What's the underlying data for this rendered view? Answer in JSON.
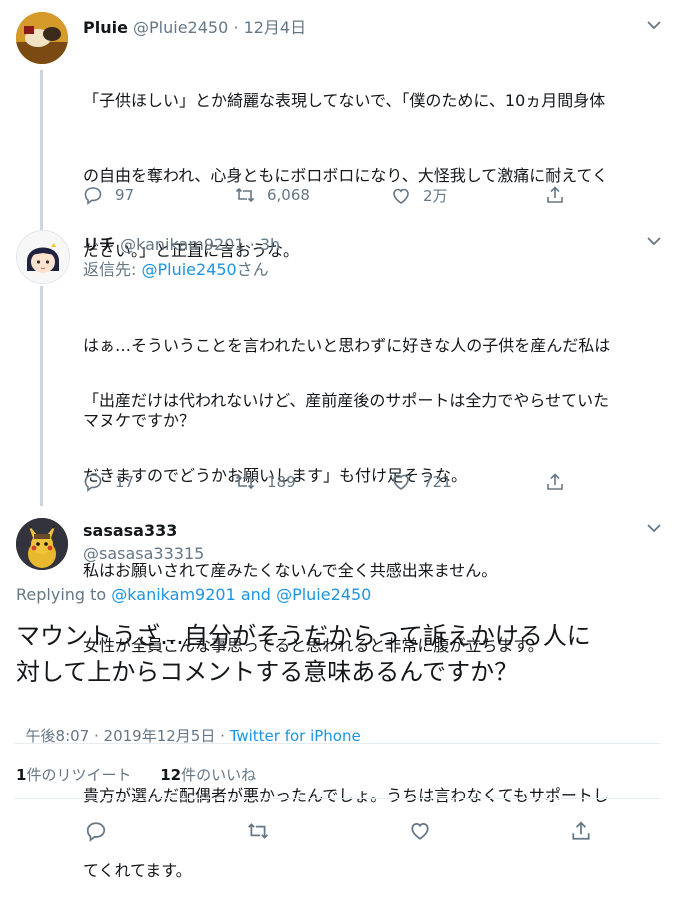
{
  "tweet1": {
    "name": "Pluie",
    "handle": "@Pluie2450",
    "dot": "·",
    "date": "12月4日",
    "para1_line1": "「子供ほしい」とか綺麗な表現してないで、「僕のために、10ヵ月間身体",
    "para1_line2": "の自由を奪われ、心身ともにボロボロになり、大怪我して激痛に耐えてく",
    "para1_line3": "ださい。」と正直に言おうな。",
    "para2_line1": "「出産だけは代われないけど、産前産後のサポートは全力でやらせていた",
    "para2_line2": "だきますのでどうかお願いします」も付け足そうな。",
    "replies": "97",
    "retweets": "6,068",
    "likes": "2万"
  },
  "tweet2": {
    "name": "リチ",
    "handle": "@kanikam9201",
    "dot": "·",
    "time": "3h",
    "reply_prefix": "返信先: ",
    "reply_to": "@Pluie2450",
    "reply_suffix": "さん",
    "line1": "はぁ…そういうことを言われたいと思わずに好きな人の子供を産んだ私は",
    "line2": "マヌケですか？",
    "line3": "私はお願いされて産みたくないんで全く共感出来ません。",
    "line4": "女性が全員こんな事思ってると思われると非常に腹が立ちます。",
    "line5": "貴方が選んだ配偶者が悪かったんでしょ。うちは言わなくてもサポートし",
    "line6": "てくれてます。",
    "replies": "17",
    "retweets": "189",
    "likes": "721"
  },
  "tweet3": {
    "name": "sasasa333",
    "handle": "@sasasa33315",
    "replying_to": "Replying to",
    "reply_user1": "@kanikam9201",
    "reply_and": "and",
    "reply_user2": "@Pluie2450",
    "line1": "マウントうざ…自分がそうだからって訴えかける人に",
    "line2": "対して上からコメントする意味あるんですか？",
    "timestamp": "午後8:07 · 2019年12月5日 · ",
    "source": "Twitter for iPhone",
    "retweet_count": "1",
    "retweet_label": "件のリツイート",
    "like_count": "12",
    "like_label": "件のいいね"
  },
  "icons": [
    "chevron-down-icon",
    "reply-icon",
    "retweet-icon",
    "like-icon",
    "share-icon"
  ],
  "colors": {
    "link": "#1b95e0",
    "muted": "#657786",
    "line": "#ccd6dd"
  }
}
